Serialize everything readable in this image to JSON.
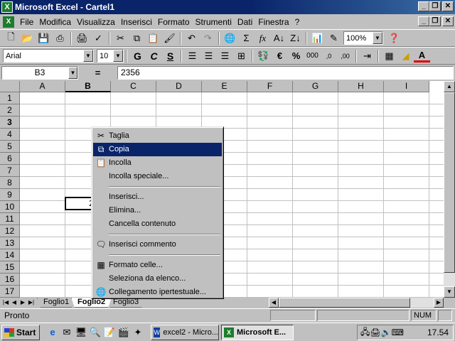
{
  "window": {
    "title": "Microsoft Excel - Cartel1",
    "app_icon": "excel-icon"
  },
  "menubar": {
    "items": [
      "File",
      "Modifica",
      "Visualizza",
      "Inserisci",
      "Formato",
      "Strumenti",
      "Dati",
      "Finestra",
      "?"
    ]
  },
  "toolbar_standard": {
    "zoom": "100%",
    "buttons": [
      "new-icon",
      "open-icon",
      "save-icon",
      "print-icon",
      "print-preview-icon",
      "spelling-icon",
      "cut-icon",
      "copy-icon",
      "paste-icon",
      "format-painter-icon",
      "undo-icon",
      "redo-icon",
      "hyperlink-icon",
      "autosum-icon",
      "function-icon",
      "sort-ascending-icon",
      "sort-descending-icon",
      "chart-wizard-icon",
      "drawing-icon",
      "help-icon"
    ]
  },
  "toolbar_formatting": {
    "font": "Arial",
    "size": "10",
    "bold": "G",
    "italic": "C",
    "underline": "S"
  },
  "formula_bar": {
    "name_box": "B3",
    "equals": "=",
    "value": "2356"
  },
  "grid": {
    "columns": [
      "A",
      "B",
      "C",
      "D",
      "E",
      "F",
      "G",
      "H",
      "I"
    ],
    "selected_column": "B",
    "rows": [
      "1",
      "2",
      "3",
      "4",
      "5",
      "6",
      "7",
      "8",
      "9",
      "10",
      "11",
      "12",
      "13",
      "14",
      "15",
      "16",
      "17"
    ],
    "selected_row": "3",
    "active_cell": {
      "ref": "B3",
      "value": "2356"
    }
  },
  "context_menu": {
    "items": [
      {
        "label": "Taglia",
        "icon": "scissors-icon"
      },
      {
        "label": "Copia",
        "icon": "copy-icon",
        "highlighted": true
      },
      {
        "label": "Incolla",
        "icon": "paste-icon"
      },
      {
        "label": "Incolla speciale..."
      },
      {
        "separator": true
      },
      {
        "label": "Inserisci..."
      },
      {
        "label": "Elimina..."
      },
      {
        "label": "Cancella contenuto"
      },
      {
        "separator": true
      },
      {
        "label": "Inserisci commento",
        "icon": "comment-icon"
      },
      {
        "separator": true
      },
      {
        "label": "Formato celle...",
        "icon": "format-cells-icon"
      },
      {
        "label": "Seleziona da elenco..."
      },
      {
        "label": "Collegamento ipertestuale...",
        "icon": "hyperlink-icon"
      }
    ]
  },
  "sheet_tabs": [
    "Foglio1",
    "Foglio2",
    "Foglio3"
  ],
  "active_sheet": "Foglio2",
  "status_bar": {
    "text": "Pronto",
    "num": "NUM"
  },
  "taskbar": {
    "start": "Start",
    "tasks": [
      {
        "label": "excel2 - Micro...",
        "icon": "word-icon"
      },
      {
        "label": "Microsoft E...",
        "icon": "excel-icon",
        "active": true
      }
    ],
    "clock": "17.54"
  },
  "colors": {
    "title_bar": "#0a246a",
    "highlight": "#0a246a",
    "face": "#c0c0c0"
  }
}
